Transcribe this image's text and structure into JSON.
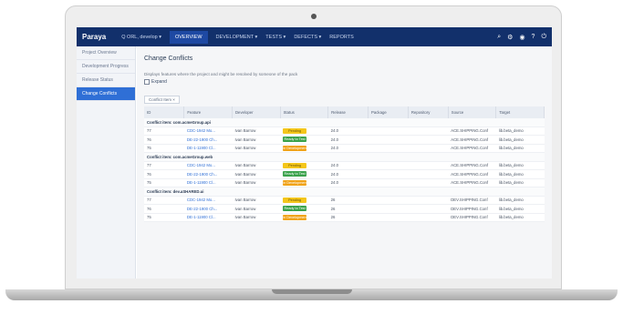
{
  "header": {
    "brand": "Paraya",
    "nav": [
      {
        "label": "Q ORL, develop ▾"
      },
      {
        "label": "OVERVIEW"
      },
      {
        "label": "DEVELOPMENT ▾"
      },
      {
        "label": "TESTS ▾"
      },
      {
        "label": "DEFECTS ▾"
      },
      {
        "label": "REPORTS"
      }
    ],
    "active_nav_index": 1
  },
  "sidebar": {
    "items": [
      {
        "label": "Project Overview"
      },
      {
        "label": "Development Progress"
      },
      {
        "label": "Release Status"
      },
      {
        "label": "Change Conflicts"
      }
    ],
    "active_index": 3
  },
  "main": {
    "title": "Change Conflicts",
    "description": "Displays features where the project and might be resolved by someone of the pack",
    "expand_label": "Expand",
    "group_by": "Conflict Item ×",
    "columns": [
      "ID",
      "Feature",
      "Developer",
      "Status",
      "Release",
      "Package",
      "Repository",
      "Source",
      "Target"
    ],
    "groups": [
      {
        "label": "Conflict item: com.acmeGroup.api",
        "rows": [
          {
            "id": "77",
            "feature": "CDC-1942 Mo...",
            "developer": "Ivan Barrow",
            "status": "Pending",
            "status_class": "pending",
            "release": "24.0",
            "package": "",
            "repository": "",
            "source": "ACE.SHIPPING.Conf",
            "target": "lib.beta_demo"
          },
          {
            "id": "76",
            "feature": "DE-22-1900 Ch...",
            "developer": "Ivan Barrow",
            "status": "Ready to Test",
            "status_class": "ready",
            "release": "24.0",
            "package": "",
            "repository": "",
            "source": "ACE.SHIPPING.Conf",
            "target": "lib.beta_demo"
          },
          {
            "id": "75",
            "feature": "DE-1-11900 Cl...",
            "developer": "Ivan Barrow",
            "status": "In Development",
            "status_class": "dev",
            "release": "24.0",
            "package": "",
            "repository": "",
            "source": "ACE.SHIPPING.Conf",
            "target": "lib.beta_demo"
          }
        ]
      },
      {
        "label": "Conflict item: com.acmeGroup.web",
        "rows": [
          {
            "id": "77",
            "feature": "CDC-1942 Mo...",
            "developer": "Ivan Barrow",
            "status": "Pending",
            "status_class": "pending",
            "release": "24.0",
            "package": "",
            "repository": "",
            "source": "ACE.SHIPPING.Conf",
            "target": "lib.beta_demo"
          },
          {
            "id": "76",
            "feature": "DE-22-1900 Ch...",
            "developer": "Ivan Barrow",
            "status": "Ready to Test",
            "status_class": "ready",
            "release": "24.0",
            "package": "",
            "repository": "",
            "source": "ACE.SHIPPING.Conf",
            "target": "lib.beta_demo"
          },
          {
            "id": "75",
            "feature": "DE-1-11900 Cl...",
            "developer": "Ivan Barrow",
            "status": "In Development",
            "status_class": "dev",
            "release": "24.0",
            "package": "",
            "repository": "",
            "source": "ACE.SHIPPING.Conf",
            "target": "lib.beta_demo"
          }
        ]
      },
      {
        "label": "Conflict item: dev.aSHARED.ui",
        "rows": [
          {
            "id": "77",
            "feature": "CDC-1942 Mo...",
            "developer": "Ivan Barrow",
            "status": "Pending",
            "status_class": "pending",
            "release": "26",
            "package": "",
            "repository": "",
            "source": "DEV.SHIPPING.Conf",
            "target": "lib.beta_demo"
          },
          {
            "id": "76",
            "feature": "DE-22-1900 Ch...",
            "developer": "Ivan Barrow",
            "status": "Ready to Test",
            "status_class": "ready",
            "release": "26",
            "package": "",
            "repository": "",
            "source": "DEV.SHIPPING.Conf",
            "target": "lib.beta_demo"
          },
          {
            "id": "75",
            "feature": "DE-1-11900 Cl...",
            "developer": "Ivan Barrow",
            "status": "In Development",
            "status_class": "dev",
            "release": "26",
            "package": "",
            "repository": "",
            "source": "DEV.SHIPPING.Conf",
            "target": "lib.beta_demo"
          }
        ]
      }
    ]
  },
  "colors": {
    "header": "#12306b",
    "active_nav": "#1e49a3",
    "sidebar_active": "#2f6fd6",
    "pending": "#f4c61b",
    "ready": "#3aa24b",
    "dev": "#f0a319"
  }
}
